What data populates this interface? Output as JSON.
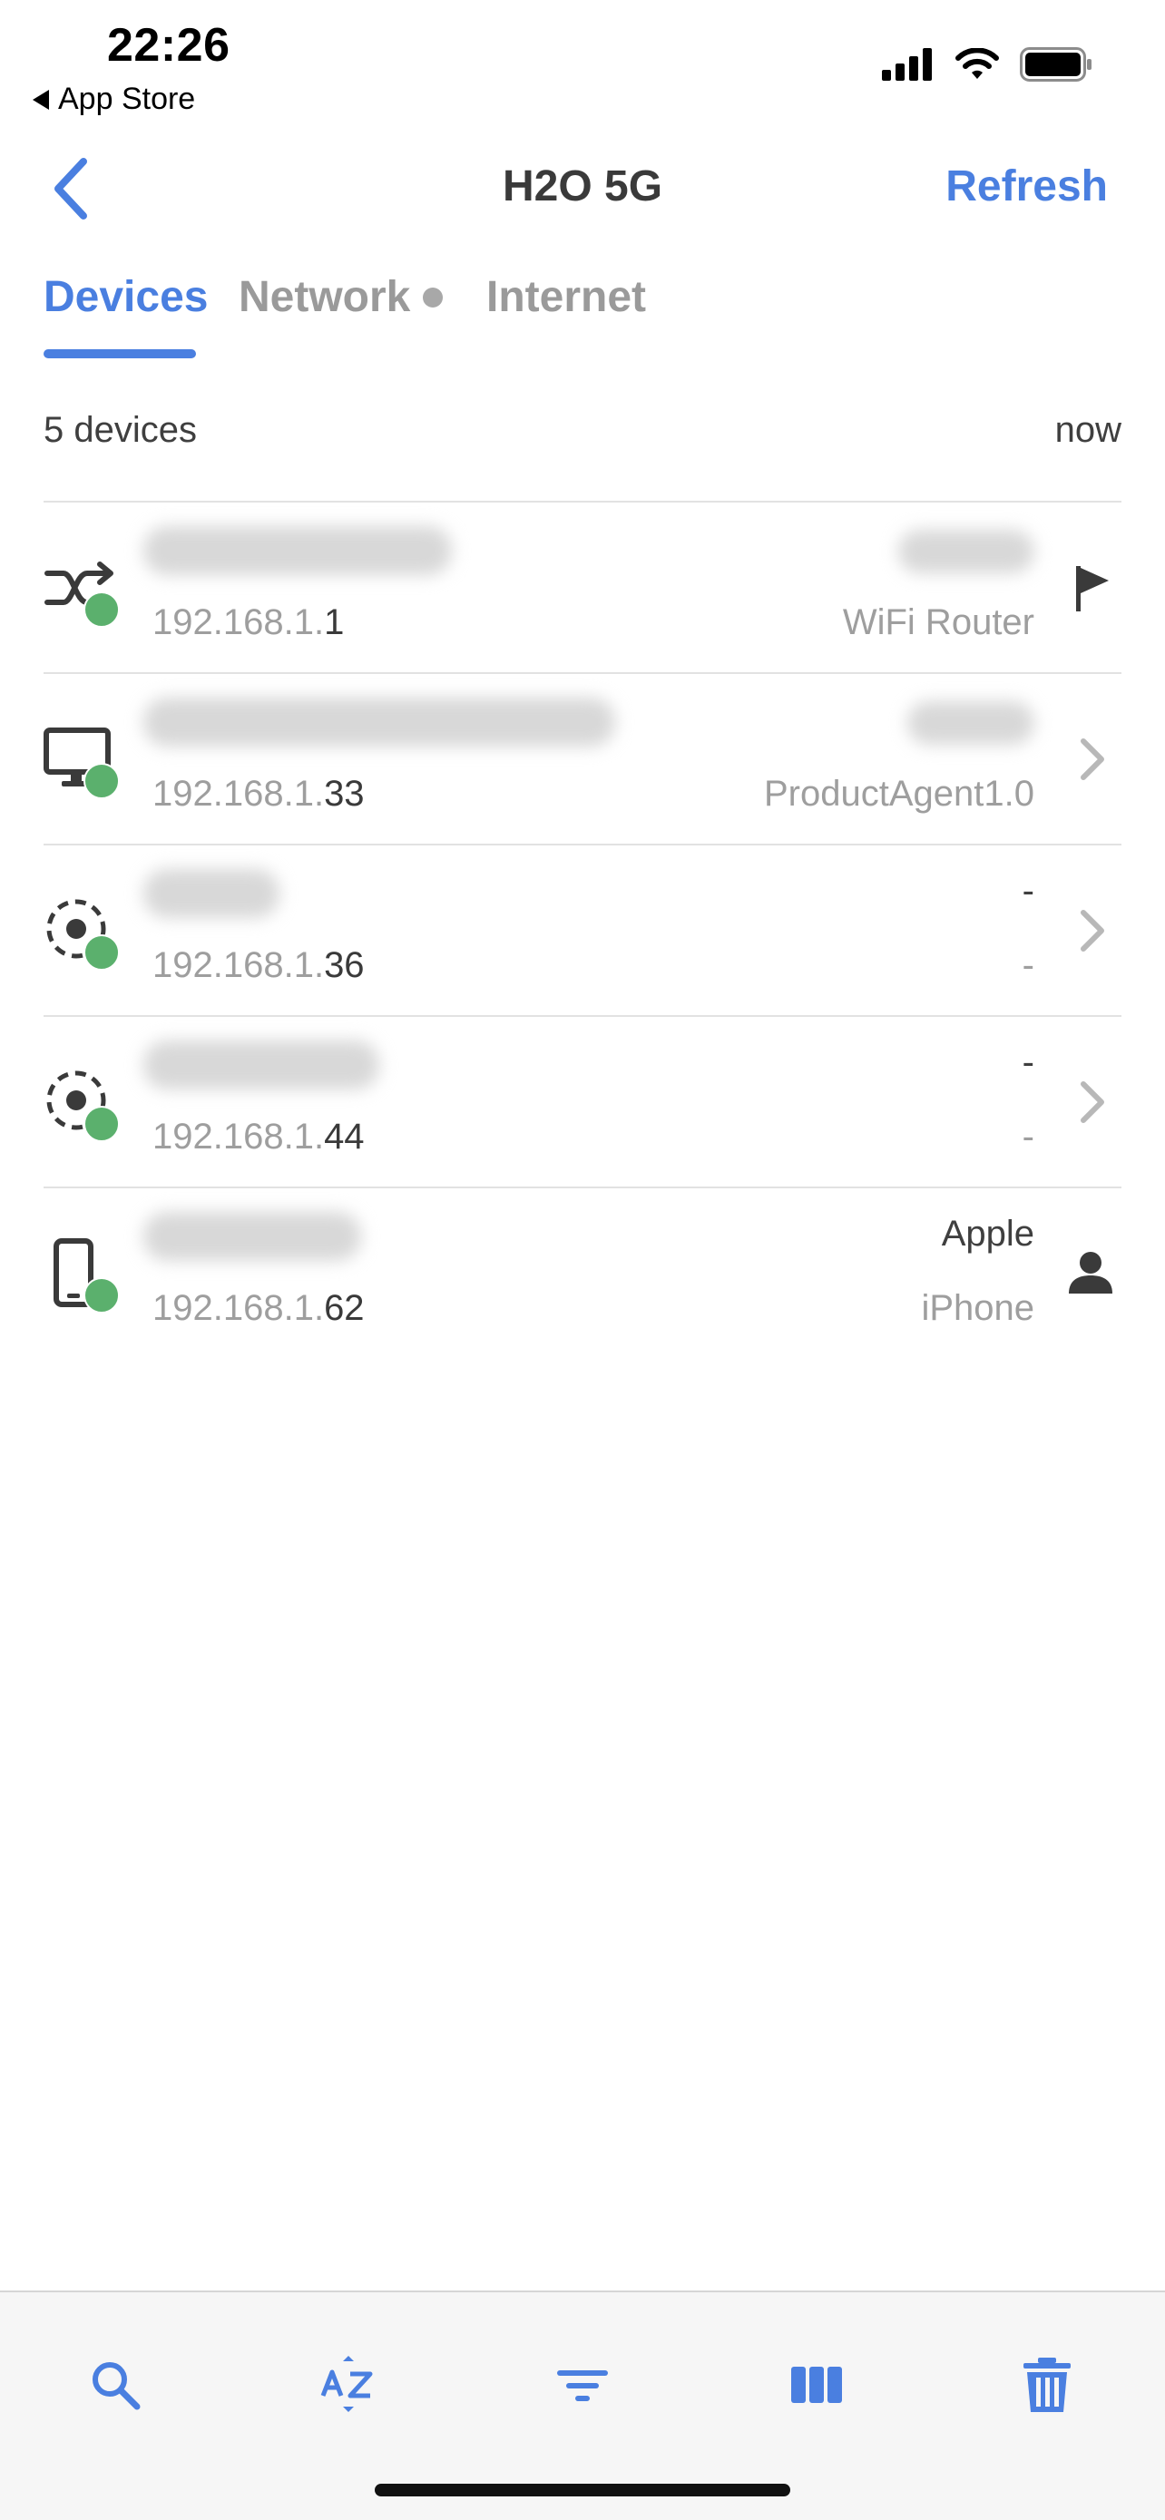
{
  "status_bar": {
    "time": "22:26",
    "back_app": "App Store"
  },
  "nav": {
    "title": "H2O 5G",
    "refresh_label": "Refresh"
  },
  "tabs": [
    {
      "label": "Devices",
      "active": true
    },
    {
      "label": "Network",
      "active": false,
      "has_dot": true
    },
    {
      "label": "Internet",
      "active": false
    }
  ],
  "summary": {
    "count": "5 devices",
    "updated": "now"
  },
  "devices": [
    {
      "icon": "router-icon",
      "ip_prefix": "192.168.1.",
      "ip_last": "1",
      "vendor": "",
      "model": "WiFi Router",
      "action": "flag-icon",
      "online": true
    },
    {
      "icon": "computer-icon",
      "ip_prefix": "192.168.1.",
      "ip_last": "33",
      "vendor": "",
      "model": "ProductAgent1.0",
      "action": "chevron-right-icon",
      "online": true
    },
    {
      "icon": "unknown-device-icon",
      "ip_prefix": "192.168.1.",
      "ip_last": "36",
      "vendor": "-",
      "model": "-",
      "action": "chevron-right-icon",
      "online": true
    },
    {
      "icon": "unknown-device-icon",
      "ip_prefix": "192.168.1.",
      "ip_last": "44",
      "vendor": "-",
      "model": "-",
      "action": "chevron-right-icon",
      "online": true
    },
    {
      "icon": "phone-icon",
      "ip_prefix": "192.168.1.",
      "ip_last": "62",
      "vendor": "Apple",
      "model": "iPhone",
      "action": "person-icon",
      "online": true
    }
  ],
  "toolbar": [
    "search-icon",
    "sort-az-icon",
    "filter-icon",
    "columns-icon",
    "trash-icon"
  ],
  "colors": {
    "accent": "#4a7fe0",
    "online": "#5bb06d",
    "muted": "#9e9e9e",
    "divider": "#e2e2e2"
  }
}
